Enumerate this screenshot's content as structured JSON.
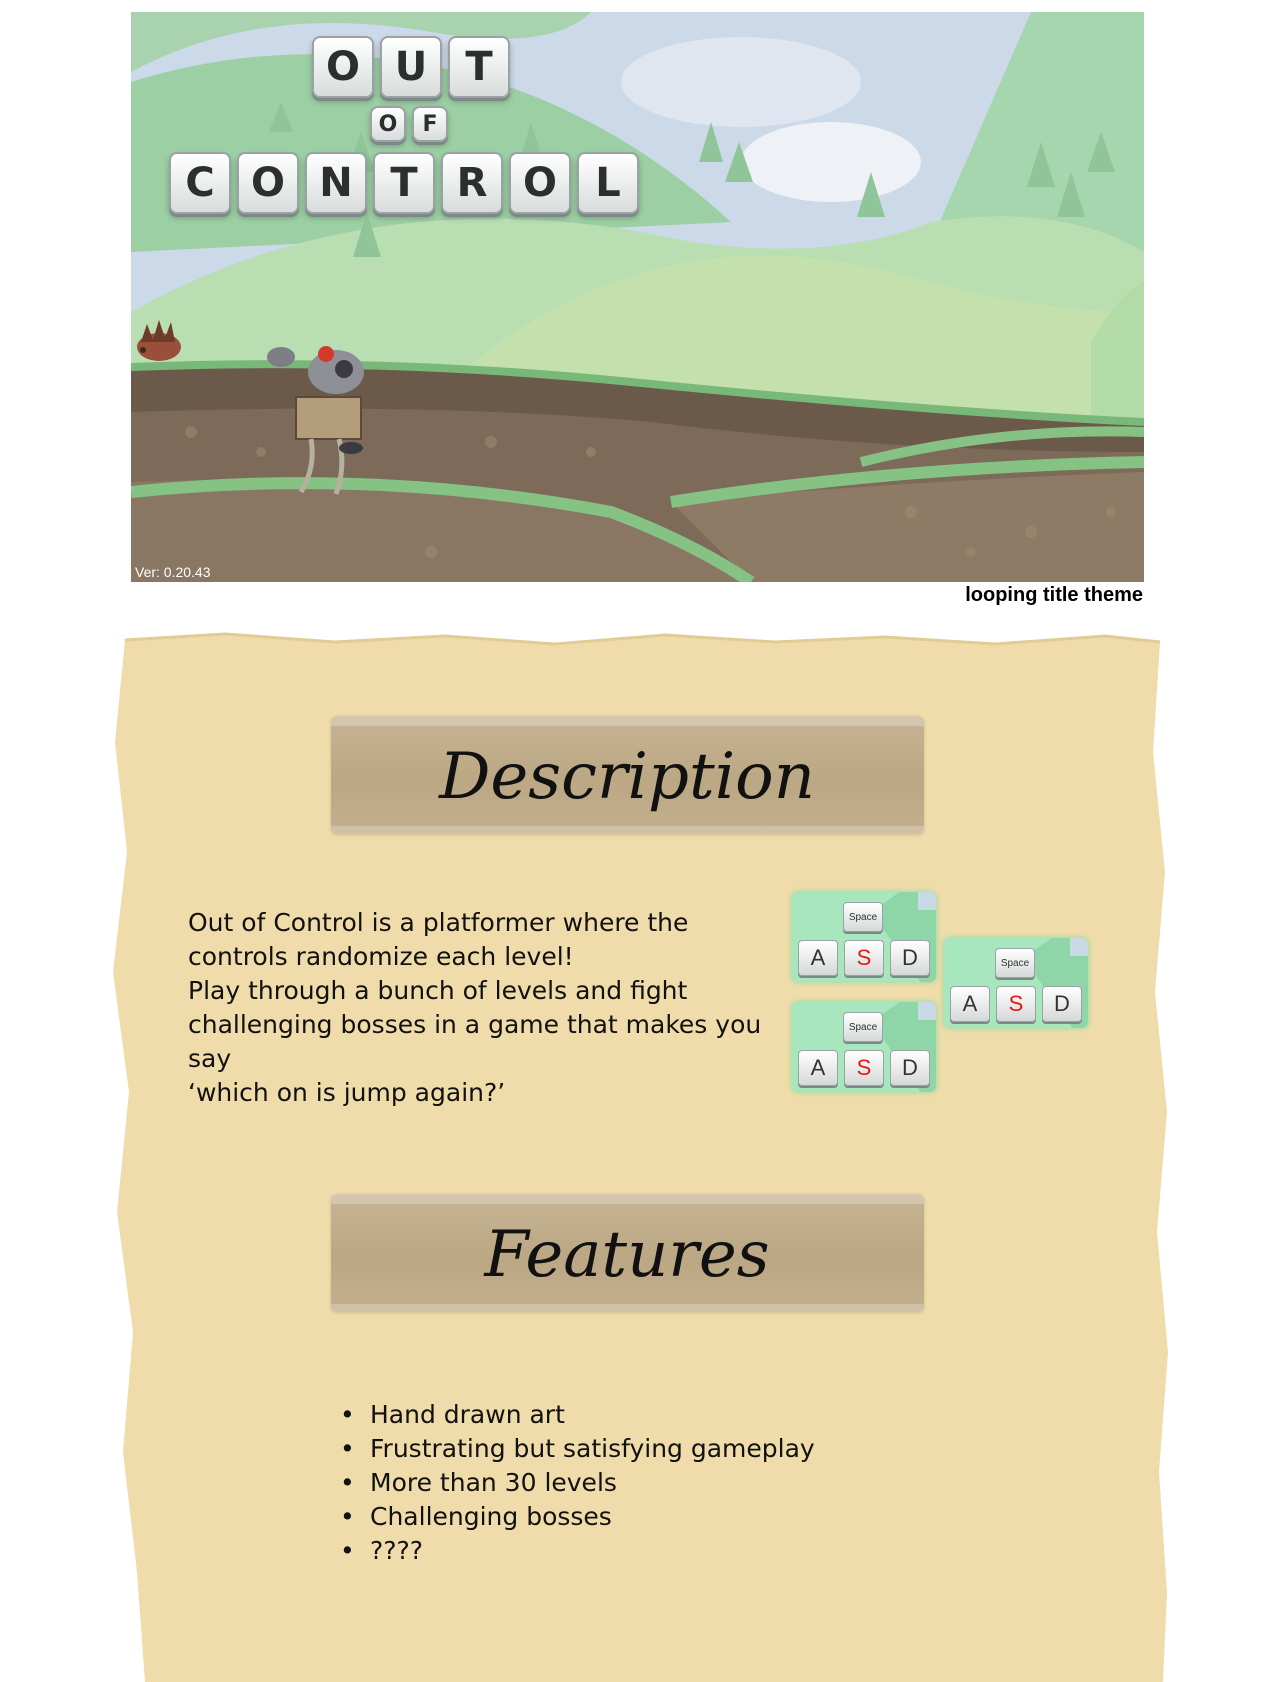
{
  "title_screen": {
    "logo_rows": [
      [
        "O",
        "U",
        "T"
      ],
      [
        "O",
        "F"
      ],
      [
        "C",
        "O",
        "N",
        "T",
        "R",
        "O",
        "L"
      ]
    ],
    "version": "Ver: 0.20.43"
  },
  "caption": "looping title theme",
  "description": {
    "heading": "Description",
    "lines": [
      "Out of Control is a platformer where the",
      "controls randomize each level!",
      "Play through a bunch of levels and fight",
      "challenging bosses in a game that makes you say",
      "‘which on is jump again?’"
    ]
  },
  "key_panels": [
    {
      "space": "Space",
      "keys": [
        "A",
        "S",
        "D"
      ]
    },
    {
      "space": "Space",
      "keys": [
        "A",
        "S",
        "D"
      ]
    },
    {
      "space": "Space",
      "keys": [
        "A",
        "S",
        "D"
      ]
    }
  ],
  "features": {
    "heading": "Features",
    "items": [
      "Hand drawn art",
      "Frustrating but satisfying gameplay",
      "More than 30 levels",
      "Challenging bosses",
      "????"
    ]
  },
  "colors": {
    "parchment": "#efdcaa",
    "tape": "#bfab88",
    "key_highlight": "#e21a1a",
    "panel_green": "#a8e6bd"
  }
}
